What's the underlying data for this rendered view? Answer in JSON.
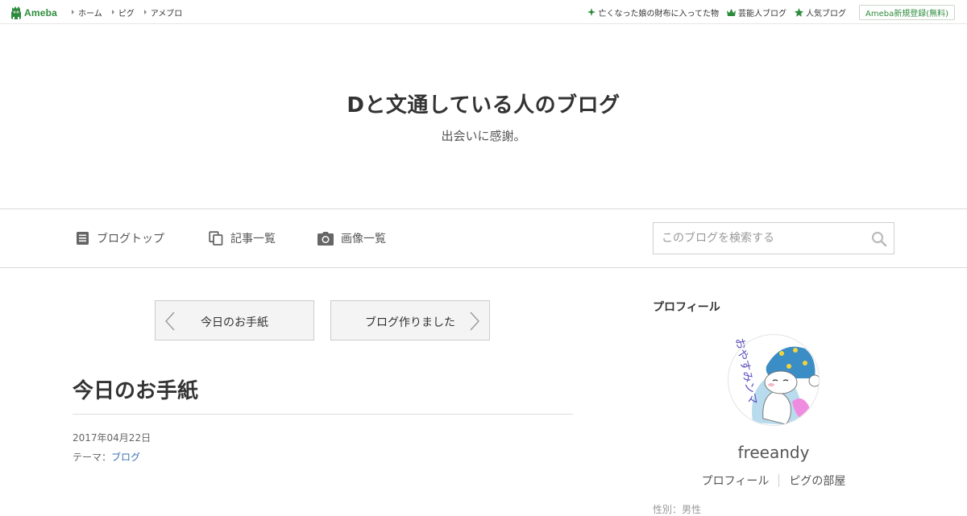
{
  "topbar": {
    "logo_text": "Ameba",
    "nav": [
      {
        "label": "ホーム"
      },
      {
        "label": "ピグ"
      },
      {
        "label": "アメブロ"
      }
    ],
    "right_links": [
      {
        "label": "亡くなった娘の財布に入ってた物",
        "icon": "sparkle-icon"
      },
      {
        "label": "芸能人ブログ",
        "icon": "crown-icon"
      },
      {
        "label": "人気ブログ",
        "icon": "star-icon"
      }
    ],
    "signup_label": "Ameba新規登録(無料)",
    "brand_color": "#2d8c3c"
  },
  "blog": {
    "title": "Dと文通している人のブログ",
    "subtitle": "出会いに感謝。"
  },
  "gnav": {
    "items": [
      {
        "label": "ブログトップ",
        "icon": "document-icon"
      },
      {
        "label": "記事一覧",
        "icon": "copy-icon"
      },
      {
        "label": "画像一覧",
        "icon": "camera-icon"
      }
    ],
    "search_placeholder": "このブログを検索する"
  },
  "pager": {
    "prev_label": "今日のお手紙",
    "next_label": "ブログ作りました"
  },
  "entry": {
    "title": "今日のお手紙",
    "date": "2017年04月22日",
    "theme_prefix": "テーマ：",
    "theme_link": "ブログ",
    "link_color": "#3a6fb0"
  },
  "sidebar": {
    "heading": "プロフィール",
    "profile_name": "freeandy",
    "avatar_text": "おやすみンマ",
    "links": [
      {
        "label": "プロフィール"
      },
      {
        "label": "ピグの部屋"
      }
    ],
    "cut_text": "性別：男性"
  }
}
